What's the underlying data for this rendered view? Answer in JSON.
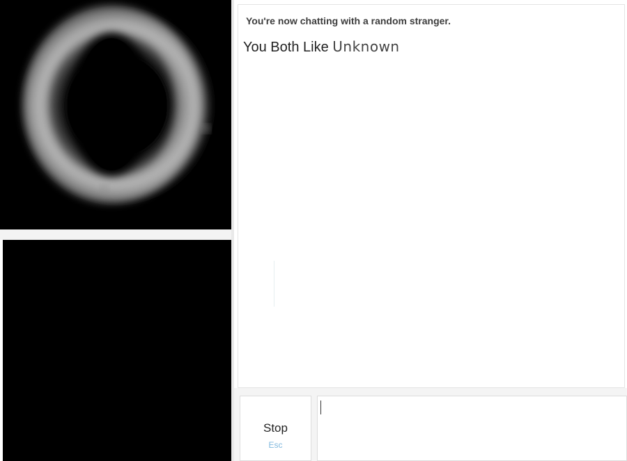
{
  "chat": {
    "status_message": "You're now chatting with a random stranger.",
    "common_interests_prefix": "You Both Like",
    "common_interest": "Unknown"
  },
  "controls": {
    "stop_label": "Stop",
    "stop_shortcut": "Esc",
    "message_placeholder": ""
  },
  "video": {
    "stranger_feed": "eye-closeup-dark",
    "self_feed": "black"
  },
  "colors": {
    "background": "#ffffff",
    "video_background": "#000000",
    "panel_border": "#e4e4e4",
    "shortcut_hint": "#7fb8de",
    "status_text": "#3d3d3d"
  }
}
